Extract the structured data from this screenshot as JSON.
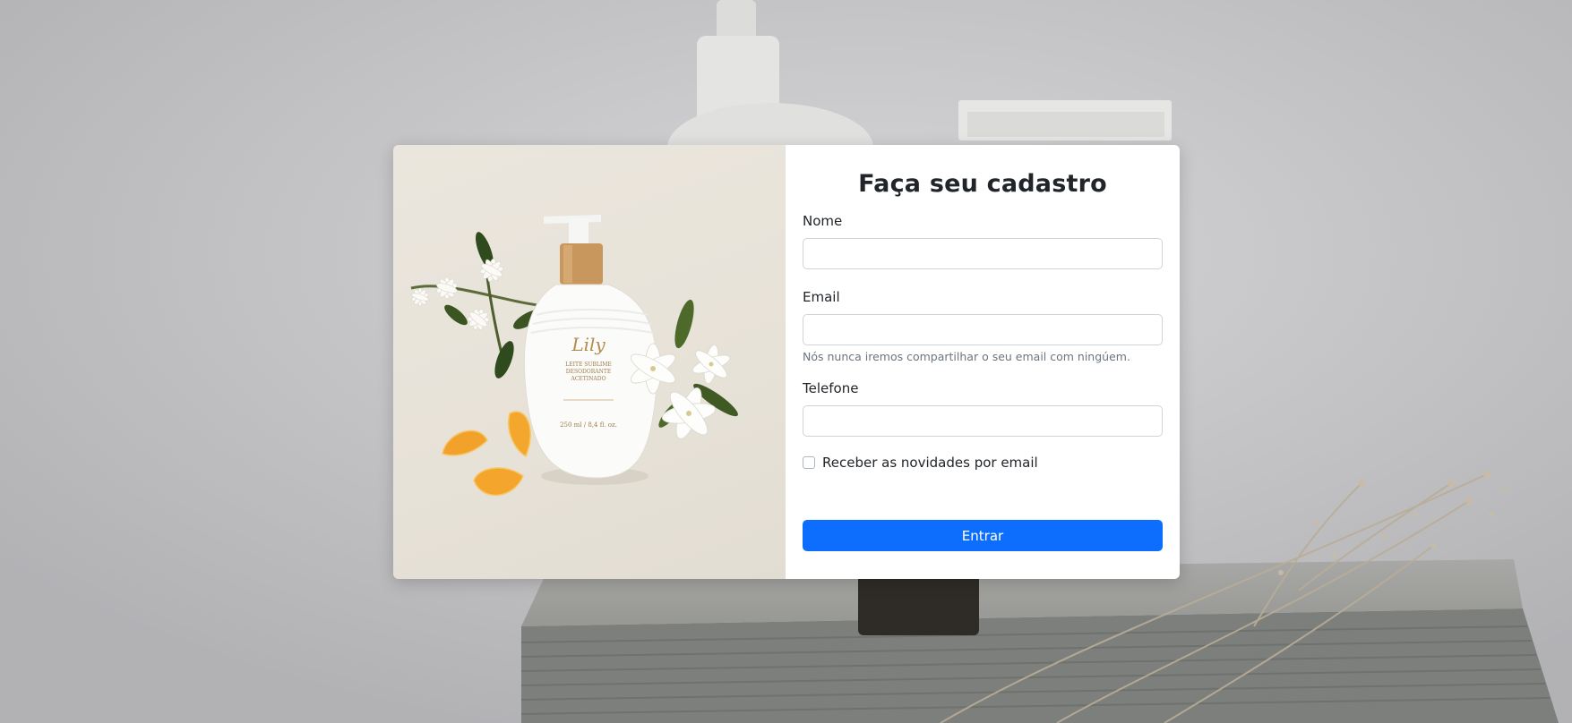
{
  "form": {
    "title": "Faça seu cadastro",
    "fields": {
      "name": {
        "label": "Nome",
        "value": "",
        "placeholder": ""
      },
      "email": {
        "label": "Email",
        "value": "",
        "placeholder": "",
        "help": "Nós nunca iremos compartilhar o seu email com ningúem."
      },
      "phone": {
        "label": "Telefone",
        "value": "",
        "placeholder": ""
      }
    },
    "newsletter": {
      "label": "Receber as novidades por email",
      "checked": false
    },
    "submit_label": "Entrar"
  },
  "product": {
    "brand": "Lily",
    "line1": "LEITE SUBLIME",
    "line2": "DESODORANTE",
    "line3": "ACETINADO",
    "volume": "250 ml / 8,4 fl. oz."
  },
  "colors": {
    "primary": "#0d6efd",
    "card_image_bg": "#e7e2d8",
    "page_bg": "#c9c9cc"
  }
}
